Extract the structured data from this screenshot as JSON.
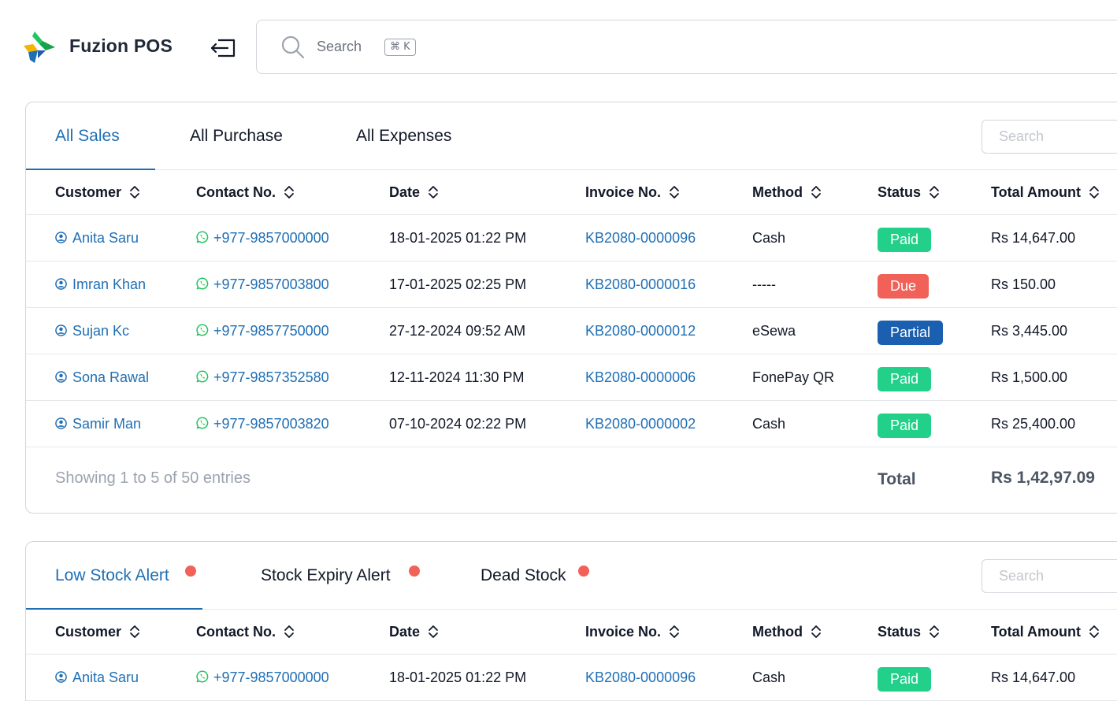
{
  "app": {
    "brand": "Fuzion POS"
  },
  "search": {
    "label": "Search",
    "shortcut": "⌘ K"
  },
  "colors": {
    "accent": "#1f6fb5",
    "paid": "#22d08a",
    "due": "#f26157",
    "partial": "#1a5fb0",
    "alert_dot": "#f26157"
  },
  "sales_card": {
    "tabs": [
      "All Sales",
      "All Purchase",
      "All Expenses"
    ],
    "search_placeholder": "Search",
    "columns": [
      "Customer",
      "Contact No.",
      "Date",
      "Invoice No.",
      "Method",
      "Status",
      "Total Amount"
    ],
    "rows": [
      {
        "customer": "Anita Saru",
        "contact": "+977-9857000000",
        "date": "18-01-2025 01:22 PM",
        "invoice": "KB2080-0000096",
        "method": "Cash",
        "status": "Paid",
        "amount": "Rs 14,647.00"
      },
      {
        "customer": "Imran Khan",
        "contact": "+977-9857003800",
        "date": "17-01-2025 02:25 PM",
        "invoice": "KB2080-0000016",
        "method": "-----",
        "status": "Due",
        "amount": "Rs 150.00"
      },
      {
        "customer": "Sujan Kc",
        "contact": "+977-9857750000",
        "date": "27-12-2024 09:52 AM",
        "invoice": "KB2080-0000012",
        "method": "eSewa",
        "status": "Partial",
        "amount": "Rs 3,445.00"
      },
      {
        "customer": "Sona Rawal",
        "contact": "+977-9857352580",
        "date": "12-11-2024 11:30 PM",
        "invoice": "KB2080-0000006",
        "method": "FonePay QR",
        "status": "Paid",
        "amount": "Rs 1,500.00"
      },
      {
        "customer": "Samir Man",
        "contact": "+977-9857003820",
        "date": "07-10-2024 02:22 PM",
        "invoice": "KB2080-0000002",
        "method": "Cash",
        "status": "Paid",
        "amount": "Rs 25,400.00"
      }
    ],
    "footer": {
      "showing": "Showing 1 to 5 of 50 entries",
      "total_label": "Total",
      "total_value": "Rs 1,42,97.09"
    }
  },
  "stock_card": {
    "tabs": [
      "Low Stock Alert",
      "Stock Expiry Alert",
      "Dead Stock"
    ],
    "search_placeholder": "Search",
    "columns": [
      "Customer",
      "Contact No.",
      "Date",
      "Invoice No.",
      "Method",
      "Status",
      "Total Amount"
    ],
    "rows": [
      {
        "customer": "Anita Saru",
        "contact": "+977-9857000000",
        "date": "18-01-2025 01:22 PM",
        "invoice": "KB2080-0000096",
        "method": "Cash",
        "status": "Paid",
        "amount": "Rs 14,647.00"
      }
    ]
  }
}
